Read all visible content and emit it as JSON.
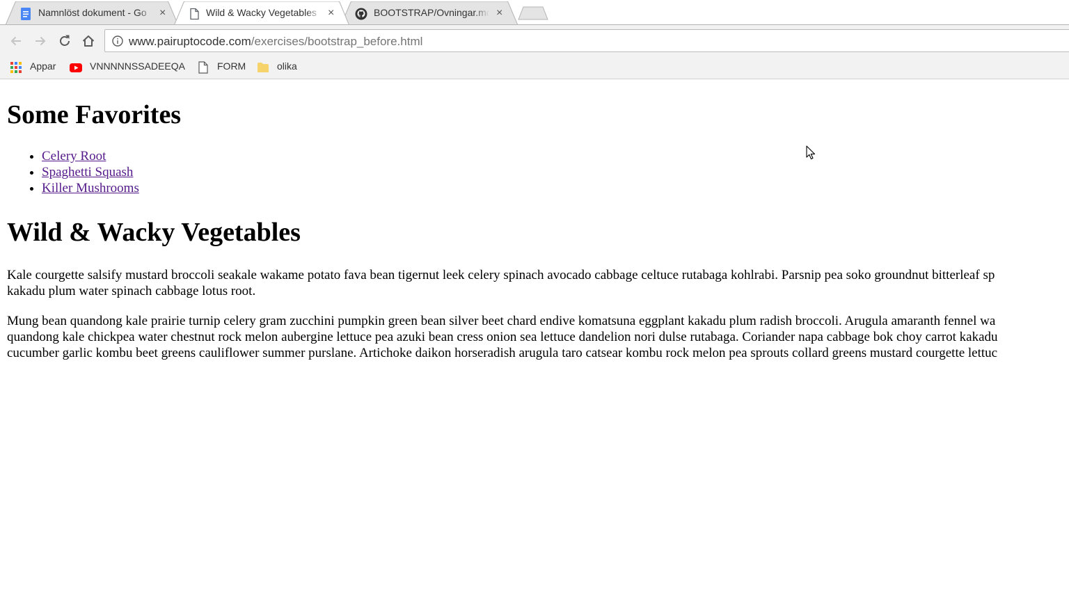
{
  "browser": {
    "tabs": [
      {
        "title": "Namnlöst dokument - Go",
        "favicon": "google-docs-icon",
        "state": "inactive"
      },
      {
        "title": "Wild & Wacky Vegetables",
        "favicon": "page-icon",
        "state": "active"
      },
      {
        "title": "BOOTSTRAP/Ovningar.md",
        "favicon": "github-icon",
        "state": "inactive"
      }
    ],
    "close_glyph": "×",
    "address": {
      "host": "www.pairuptocode.com",
      "path": "/exercises/bootstrap_before.html"
    },
    "bookmarks": [
      {
        "label": "Appar",
        "icon": "apps-grid-icon"
      },
      {
        "label": "VNNNNNSSADEEQA",
        "icon": "youtube-icon"
      },
      {
        "label": "FORM",
        "icon": "page-icon"
      },
      {
        "label": "olika",
        "icon": "folder-icon"
      }
    ],
    "colors": {
      "youtube": "#ff0000",
      "folder": "#f7d36b",
      "docs": "#4a86f5",
      "visited_link": "#551a8b"
    }
  },
  "page": {
    "favorites_heading": "Some Favorites",
    "favorites": [
      "Celery Root",
      "Spaghetti Squash",
      "Killer Mushrooms"
    ],
    "main_heading": "Wild & Wacky Vegetables",
    "paragraph1": [
      "Kale courgette salsify mustard broccoli seakale wakame potato fava bean tigernut leek celery spinach avocado cabbage celtuce rutabaga kohlrabi. Parsnip pea soko groundnut bitterleaf sp",
      "kakadu plum water spinach cabbage lotus root."
    ],
    "paragraph2": [
      "Mung bean quandong kale prairie turnip celery gram zucchini pumpkin green bean silver beet chard endive komatsuna eggplant kakadu plum radish broccoli. Arugula amaranth fennel wa",
      "quandong kale chickpea water chestnut rock melon aubergine lettuce pea azuki bean cress onion sea lettuce dandelion nori dulse rutabaga. Coriander napa cabbage bok choy carrot kakadu",
      "cucumber garlic kombu beet greens cauliflower summer purslane. Artichoke daikon horseradish arugula taro catsear kombu rock melon pea sprouts collard greens mustard courgette lettuc"
    ]
  }
}
